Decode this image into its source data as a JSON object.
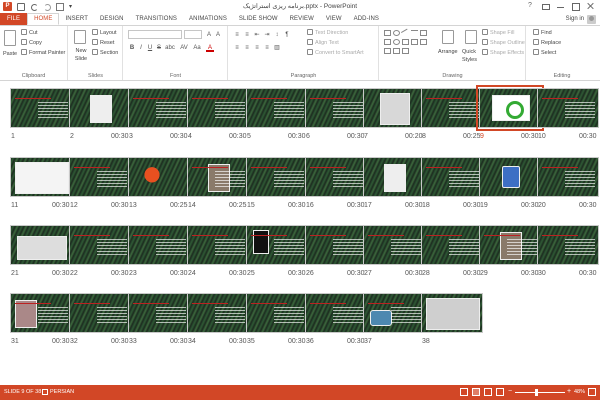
{
  "app": {
    "title": "برنامه ریزی استراتژیک.pptx - PowerPoint",
    "sign_in": "Sign in"
  },
  "tabs": [
    "FILE",
    "HOME",
    "INSERT",
    "DESIGN",
    "TRANSITIONS",
    "ANIMATIONS",
    "SLIDE SHOW",
    "REVIEW",
    "VIEW",
    "ADD-INS"
  ],
  "active_tab": "HOME",
  "ribbon": {
    "clipboard": {
      "paste": "Paste",
      "cut": "Cut",
      "copy": "Copy",
      "format_painter": "Format Painter",
      "label": "Clipboard"
    },
    "slides": {
      "new_slide": "New Slide",
      "layout": "Layout",
      "reset": "Reset",
      "section": "Section",
      "label": "Slides"
    },
    "font": {
      "label": "Font",
      "bold": "B",
      "italic": "I",
      "underline": "U",
      "strike": "S",
      "shadow": "abc",
      "spacing": "AV",
      "case": "Aa",
      "color": "A"
    },
    "paragraph": {
      "text_direction": "Text Direction",
      "align_text": "Align Text",
      "convert_smartart": "Convert to SmartArt",
      "label": "Paragraph"
    },
    "drawing": {
      "arrange": "Arrange",
      "quick_styles": "Quick Styles",
      "shape_fill": "Shape Fill",
      "shape_outline": "Shape Outline",
      "shape_effects": "Shape Effects",
      "label": "Drawing"
    },
    "editing": {
      "find": "Find",
      "replace": "Replace",
      "select": "Select",
      "label": "Editing"
    }
  },
  "slides": [
    {
      "num": "1",
      "time": "",
      "kind": "title"
    },
    {
      "num": "2",
      "time": "00:30",
      "kind": "photo-sea"
    },
    {
      "num": "3",
      "time": "00:30",
      "kind": "text"
    },
    {
      "num": "4",
      "time": "00:30",
      "kind": "text"
    },
    {
      "num": "5",
      "time": "00:30",
      "kind": "text"
    },
    {
      "num": "6",
      "time": "00:30",
      "kind": "text"
    },
    {
      "num": "7",
      "time": "00:20",
      "kind": "face"
    },
    {
      "num": "8",
      "time": "00:25",
      "kind": "text"
    },
    {
      "num": "9",
      "time": "00:30",
      "kind": "recycle"
    },
    {
      "num": "10",
      "time": "00:30",
      "kind": "text"
    },
    {
      "num": "11",
      "time": "00:30",
      "kind": "flow"
    },
    {
      "num": "12",
      "time": "00:30",
      "kind": "text"
    },
    {
      "num": "13",
      "time": "00:25",
      "kind": "mushroom"
    },
    {
      "num": "14",
      "time": "00:25",
      "kind": "photo"
    },
    {
      "num": "15",
      "time": "00:30",
      "kind": "text"
    },
    {
      "num": "16",
      "time": "00:30",
      "kind": "text"
    },
    {
      "num": "17",
      "time": "00:30",
      "kind": "photo-white"
    },
    {
      "num": "18",
      "time": "00:30",
      "kind": "text"
    },
    {
      "num": "19",
      "time": "00:30",
      "kind": "blue"
    },
    {
      "num": "20",
      "time": "00:30",
      "kind": "text"
    },
    {
      "num": "21",
      "time": "00:30",
      "kind": "diagram"
    },
    {
      "num": "22",
      "time": "00:30",
      "kind": "text"
    },
    {
      "num": "23",
      "time": "00:30",
      "kind": "text"
    },
    {
      "num": "24",
      "time": "00:30",
      "kind": "text"
    },
    {
      "num": "25",
      "time": "00:30",
      "kind": "bulb"
    },
    {
      "num": "26",
      "time": "00:30",
      "kind": "text"
    },
    {
      "num": "27",
      "time": "00:30",
      "kind": "text"
    },
    {
      "num": "28",
      "time": "00:30",
      "kind": "text"
    },
    {
      "num": "29",
      "time": "00:30",
      "kind": "photo"
    },
    {
      "num": "30",
      "time": "00:30",
      "kind": "text"
    },
    {
      "num": "31",
      "time": "00:30",
      "kind": "person"
    },
    {
      "num": "32",
      "time": "00:30",
      "kind": "text"
    },
    {
      "num": "33",
      "time": "00:30",
      "kind": "text"
    },
    {
      "num": "34",
      "time": "00:30",
      "kind": "text"
    },
    {
      "num": "35",
      "time": "00:30",
      "kind": "text"
    },
    {
      "num": "36",
      "time": "00:30",
      "kind": "text"
    },
    {
      "num": "37",
      "time": "",
      "kind": "globe"
    },
    {
      "num": "38",
      "time": "",
      "kind": "laptop"
    }
  ],
  "selected_slide": "9",
  "status": {
    "slide_indicator": "SLIDE 9 OF 38",
    "language": "PERSIAN",
    "zoom": "48%"
  },
  "colors": {
    "accent": "#d24726"
  }
}
